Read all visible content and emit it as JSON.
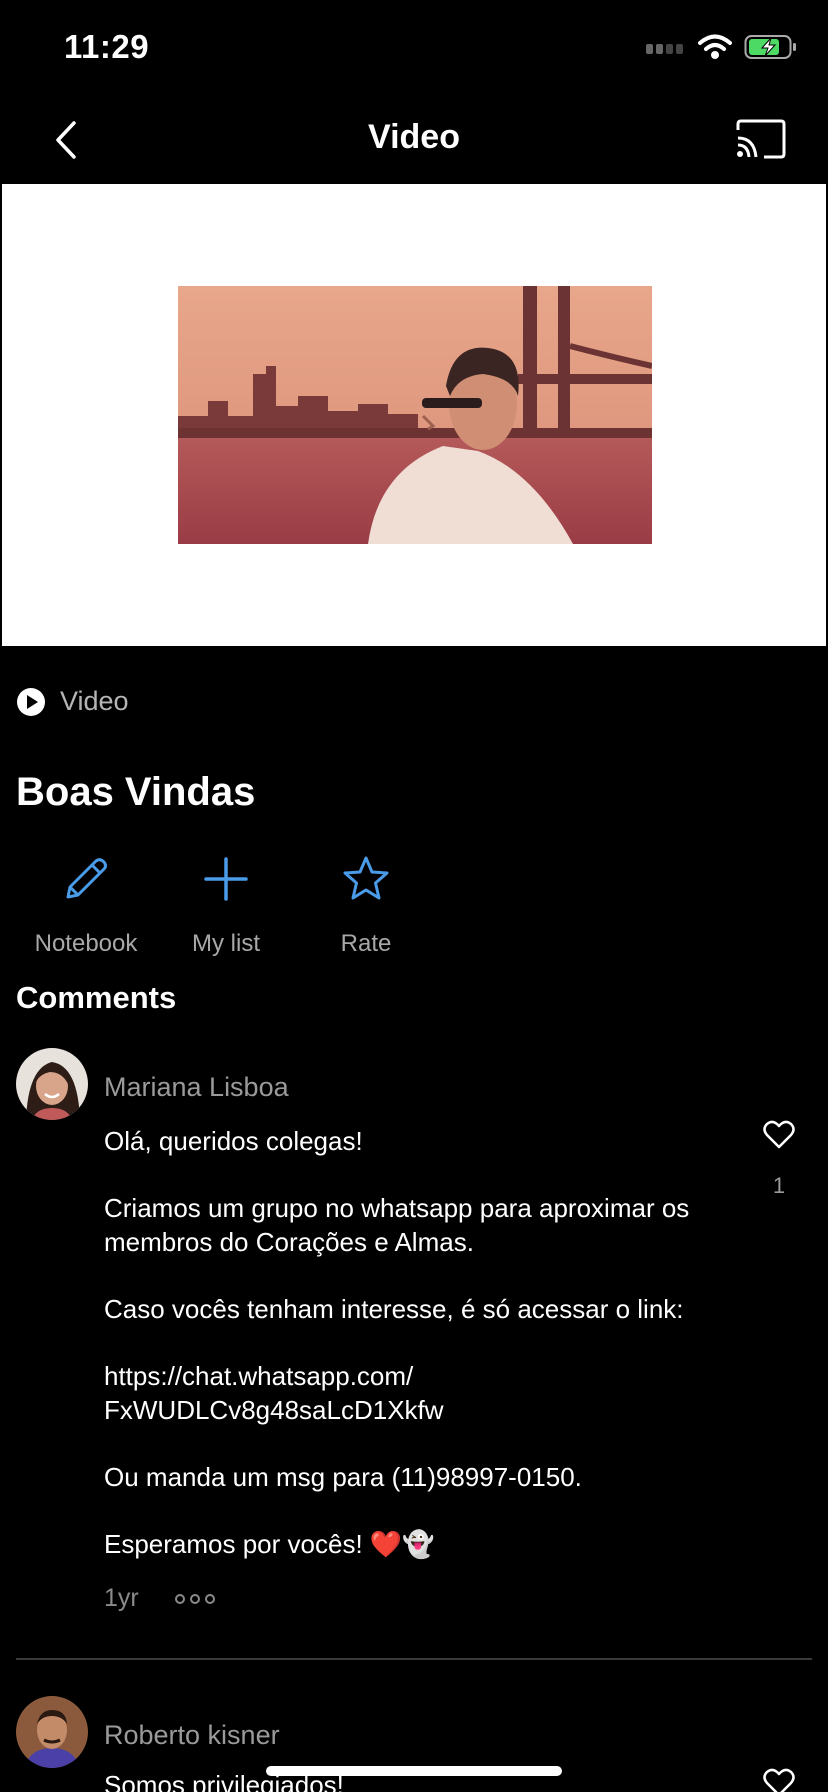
{
  "status": {
    "time": "11:29"
  },
  "nav": {
    "title": "Video"
  },
  "content": {
    "type_label": "Video",
    "title": "Boas Vindas"
  },
  "actions": [
    {
      "label": "Notebook",
      "icon": "pencil-icon"
    },
    {
      "label": "My list",
      "icon": "plus-icon"
    },
    {
      "label": "Rate",
      "icon": "star-icon"
    }
  ],
  "comments": {
    "title": "Comments",
    "items": [
      {
        "author": "Mariana Lisboa",
        "paragraphs": [
          "Olá, queridos colegas!",
          "Criamos um grupo no whatsapp para aproximar os membros do Corações e Almas.",
          "Caso vocês tenham interesse, é só acessar o link:",
          "https://chat.whatsapp.com/ FxWUDLCv8g48saLcD1Xkfw",
          "Ou manda um msg para (11)98997-0150.",
          "Esperamos por vocês! ❤️👻"
        ],
        "likes": "1",
        "time": "1yr"
      },
      {
        "author": "Roberto kisner",
        "paragraphs": [
          "Somos privilegiados!"
        ]
      }
    ]
  },
  "colors": {
    "accent": "#4a9be8",
    "background": "#000000",
    "muted": "#9a9a9a"
  }
}
